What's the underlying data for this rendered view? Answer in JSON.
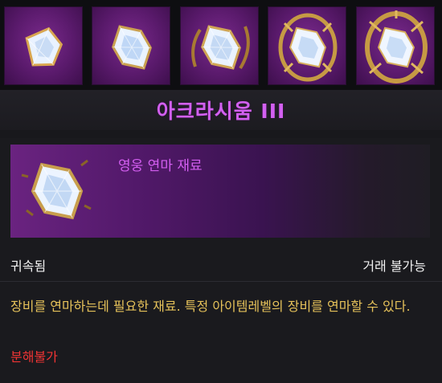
{
  "gem_slots": [
    {
      "icon": "crystal-icon-tier-1",
      "tier": 1
    },
    {
      "icon": "crystal-icon-tier-2",
      "tier": 2
    },
    {
      "icon": "crystal-icon-tier-3",
      "tier": 3
    },
    {
      "icon": "crystal-icon-tier-4",
      "tier": 4
    },
    {
      "icon": "crystal-icon-tier-5",
      "tier": 5
    }
  ],
  "tooltip": {
    "item_name": "아크라시움 III",
    "item_grade": "영웅 연마 재료",
    "bound": "귀속됨",
    "trade": "거래 불가능",
    "description": "장비를 연마하는데 필요한 재료. 특정 아이템레벨의 장비를 연마할 수 있다.",
    "disassemble": "분해불가"
  },
  "colors": {
    "name": "#d260f0",
    "grade": "#d35ef0",
    "description": "#e6c25a",
    "warning": "#f03434",
    "slot_bg": "#5a1a6c"
  }
}
